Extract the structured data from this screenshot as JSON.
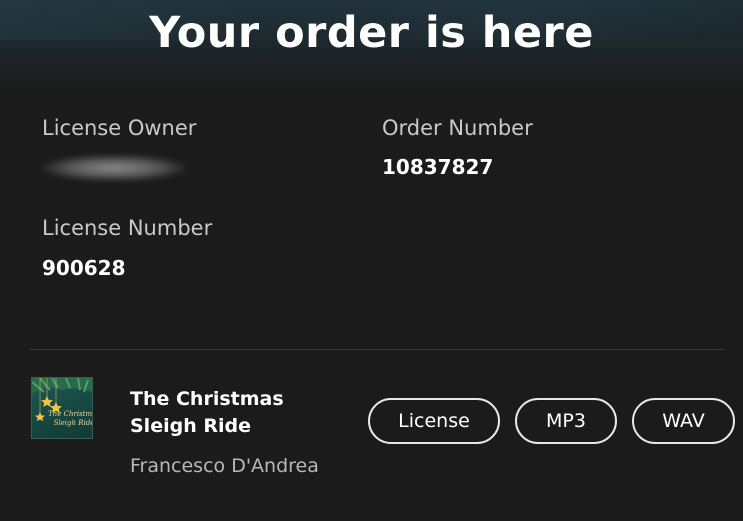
{
  "header": {
    "title": "Your order is here"
  },
  "order": {
    "license_owner_label": "License Owner",
    "order_number_label": "Order Number",
    "order_number": "10837827",
    "license_number_label": "License Number",
    "license_number": "900628"
  },
  "track": {
    "title": "The Christmas Sleigh Ride",
    "artist": "Francesco D'Andrea",
    "artwork_icon": "christmas-cover-art"
  },
  "actions": {
    "license_label": "License",
    "mp3_label": "MP3",
    "wav_label": "WAV"
  },
  "colors": {
    "background": "#1b1b1b",
    "text_primary": "#ffffff",
    "text_secondary": "#c9c9c9",
    "pill_border": "#e8e8e8",
    "divider": "#3a3a3a"
  }
}
